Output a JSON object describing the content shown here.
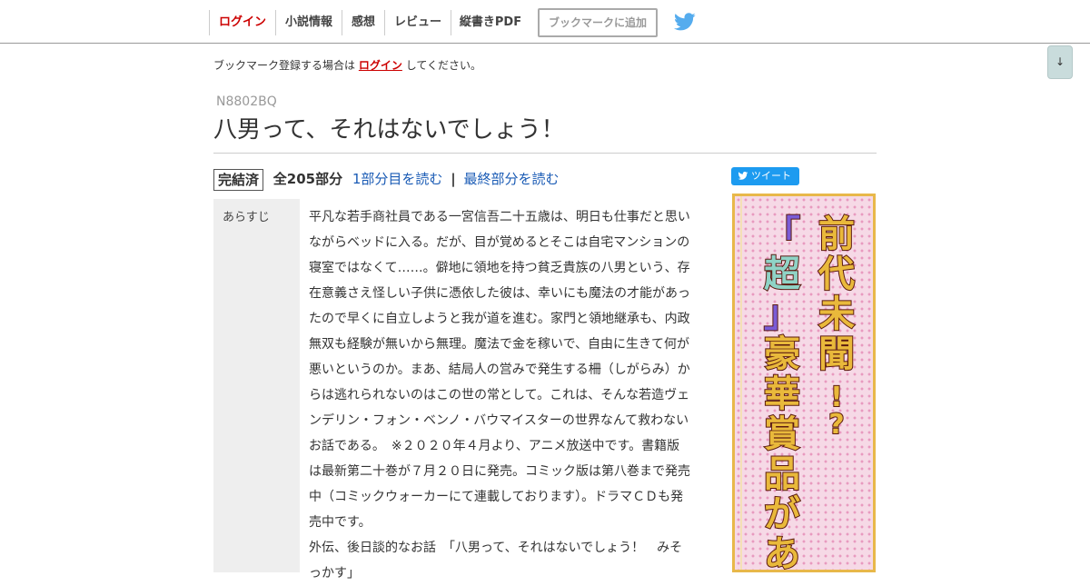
{
  "nav": {
    "items": [
      {
        "label": "ログイン",
        "name": "nav-login"
      },
      {
        "label": "小説情報",
        "name": "nav-novel-info"
      },
      {
        "label": "感想",
        "name": "nav-impressions"
      },
      {
        "label": "レビュー",
        "name": "nav-review"
      },
      {
        "label": "縦書きPDF",
        "name": "nav-vertical-pdf"
      }
    ],
    "bookmark_add": "ブックマークに追加",
    "twitter_icon": "twitter-bird-icon"
  },
  "scroll_button": "↓",
  "bookmark_note": {
    "before": "ブックマーク登録する場合は",
    "link": "ログイン",
    "after": "してください。"
  },
  "novel": {
    "ncode": "N8802BQ",
    "title": "八男って、それはないでしょう！",
    "status": "完結済",
    "parts": "全205部分",
    "read_first": "1部分目を読む",
    "separator": "|",
    "read_last": "最終部分を読む"
  },
  "summary": {
    "label": "あらすじ",
    "paragraph1": "平凡な若手商社員である一宮信吾二十五歳は、明日も仕事だと思いながらベッドに入る。だが、目が覚めるとそこは自宅マンションの寝室ではなくて……。僻地に領地を持つ貧乏貴族の八男という、存在意義さえ怪しい子供に憑依した彼は、幸いにも魔法の才能があったので早くに自立しようと我が道を進む。家門と領地継承も、内政無双も経験が無いから無理。魔法で金を稼いで、自由に生きて何が悪いというのか。まあ、結局人の営みで発生する柵（しがらみ）からは逃れられないのはこの世の常として。これは、そんな若造ヴェンデリン・フォン・ベンノ・バウマイスターの世界なんて救わないお話である。　※２０２０年４月より、アニメ放送中です。書籍版は最新第二十巻が７月２０日に発売。コミック版は第八巻まで発売中（コミックウォーカーにて連載しております）。ドラマＣＤも発売中です。",
    "paragraph2": "外伝、後日談的なお話　「八男って、それはないでしょう！　みそっかす」"
  },
  "tweet_button": "ツイート",
  "ad": {
    "text": "前代未聞!?「超」豪華賞品があ",
    "colors": {
      "background": "#f6d9e6",
      "border": "#e8b84a",
      "text": "#c21a1a"
    }
  }
}
